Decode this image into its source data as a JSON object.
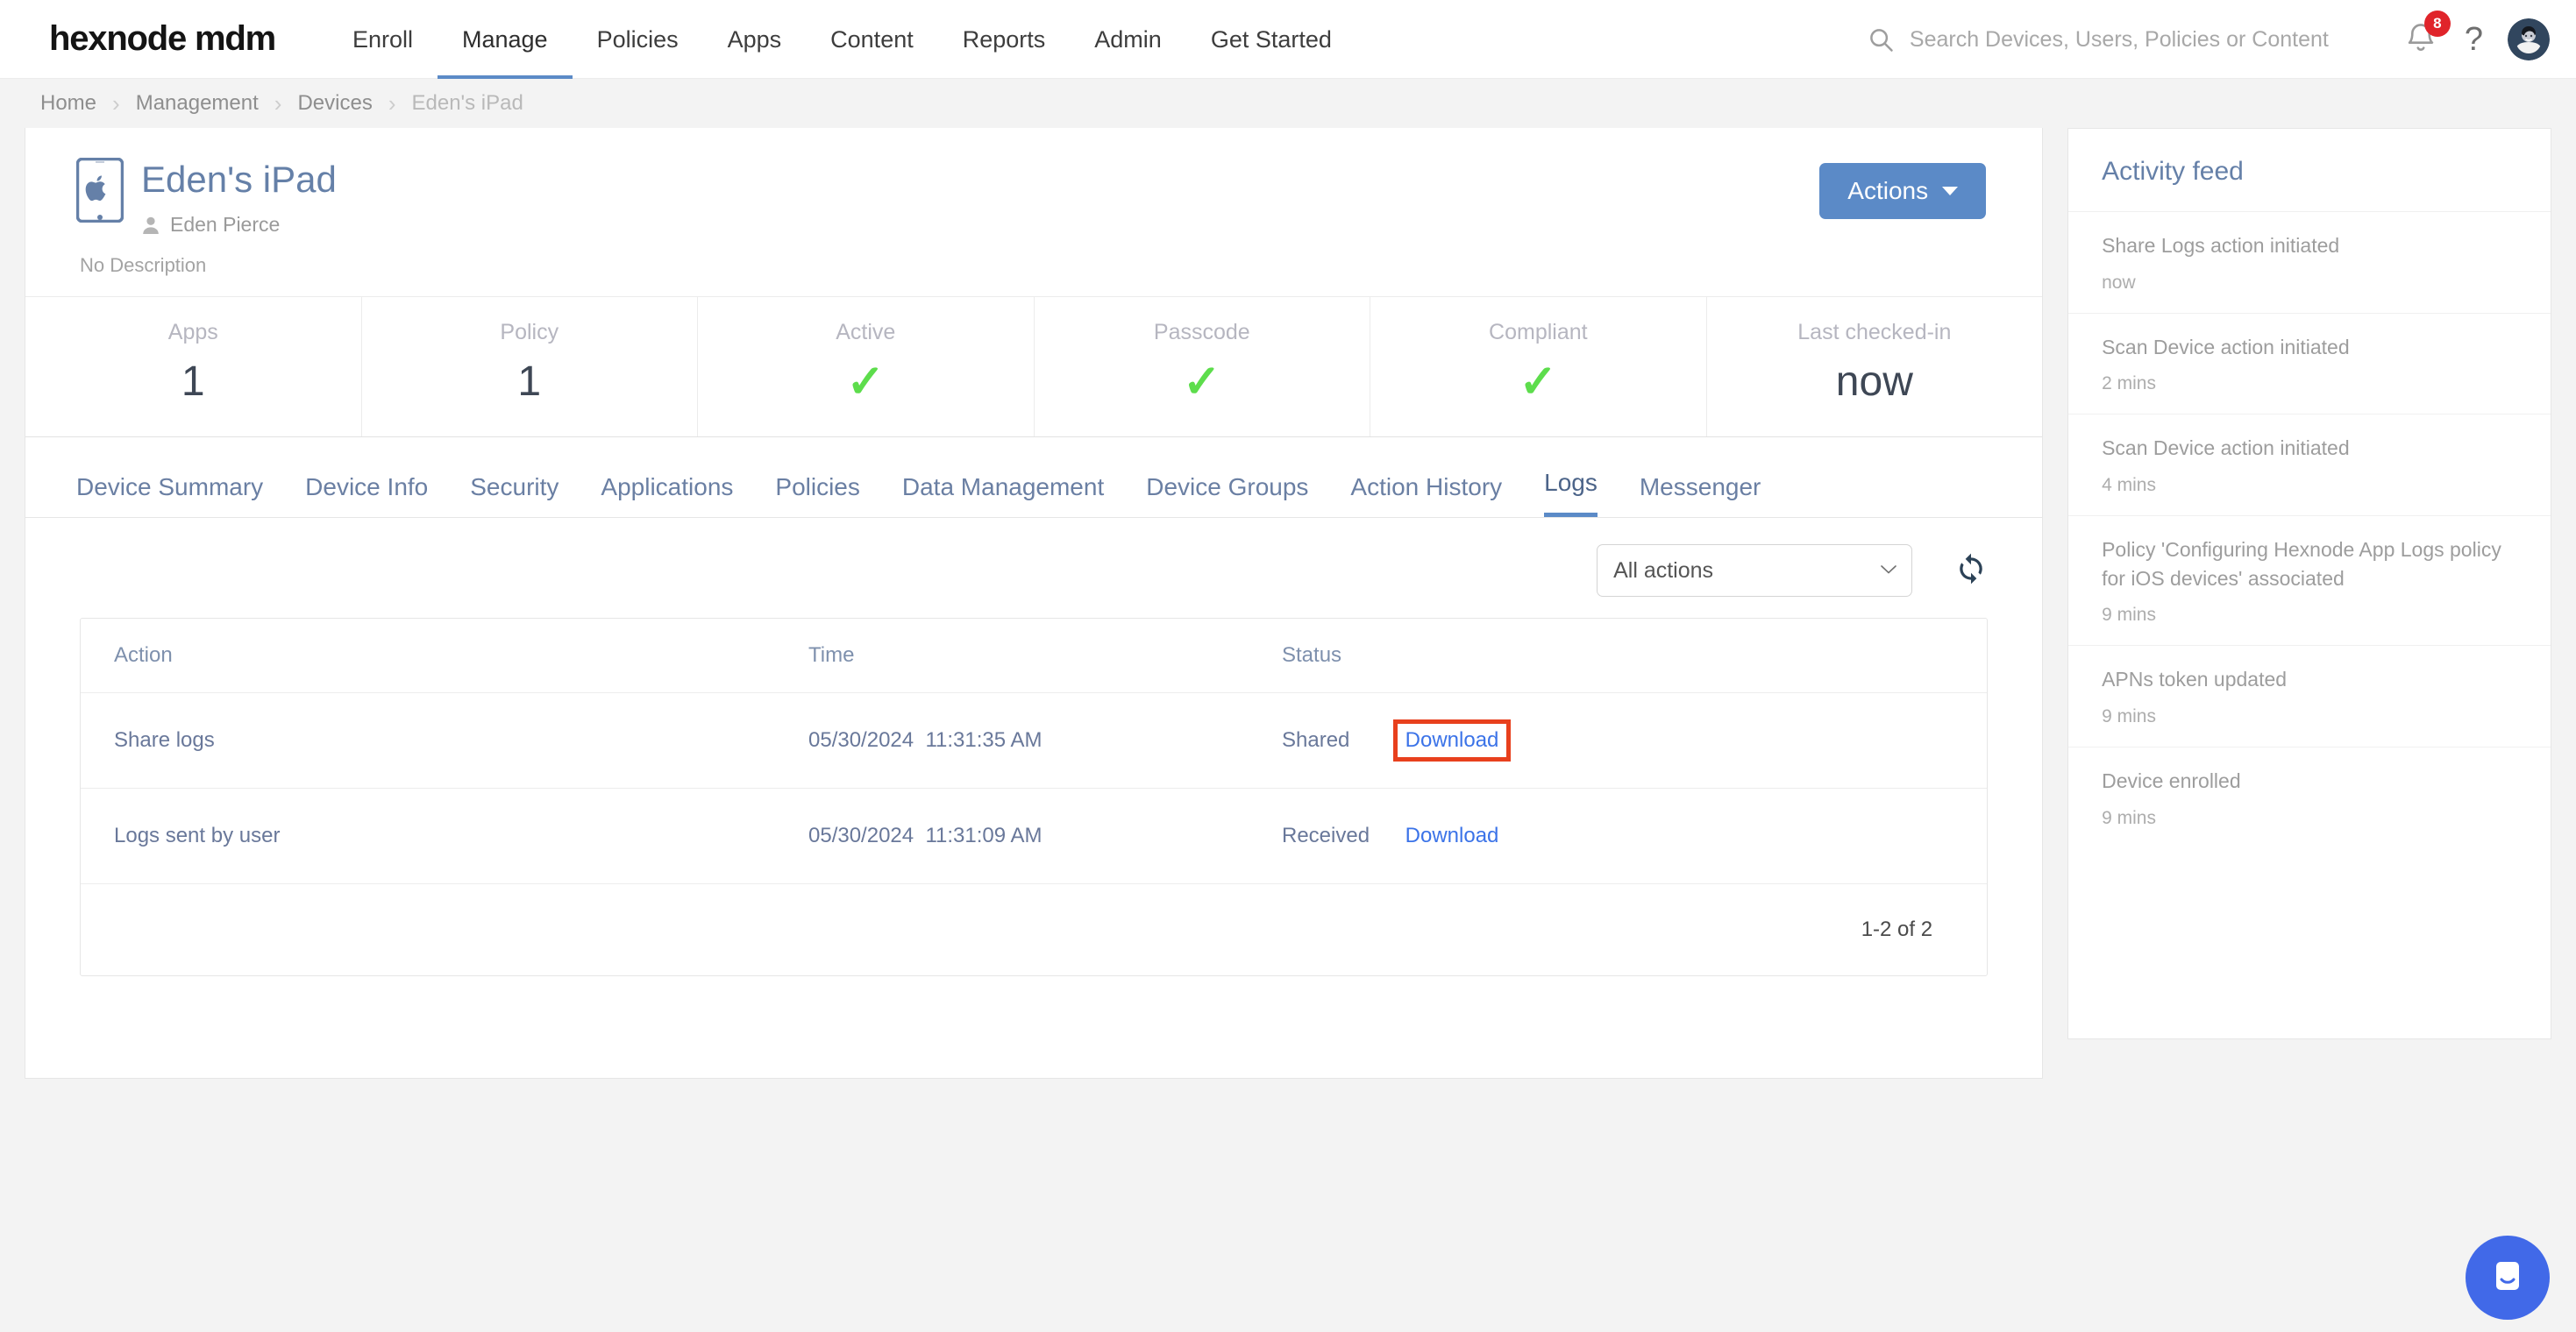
{
  "topnav": {
    "brand": "hexnode mdm",
    "items": [
      {
        "label": "Enroll",
        "active": false
      },
      {
        "label": "Manage",
        "active": true
      },
      {
        "label": "Policies",
        "active": false
      },
      {
        "label": "Apps",
        "active": false
      },
      {
        "label": "Content",
        "active": false
      },
      {
        "label": "Reports",
        "active": false
      },
      {
        "label": "Admin",
        "active": false
      },
      {
        "label": "Get Started",
        "active": false
      }
    ],
    "search_placeholder": "Search Devices, Users, Policies or Content",
    "notification_count": "8",
    "help_glyph": "?",
    "colors": {
      "badge": "#e0242a",
      "active_underline": "#5b8ac7"
    }
  },
  "breadcrumb": {
    "items": [
      "Home",
      "Management",
      "Devices",
      "Eden's iPad"
    ],
    "separator": "›"
  },
  "device": {
    "name": "Eden's iPad",
    "owner": "Eden Pierce",
    "description": "No Description",
    "actions_button": "Actions"
  },
  "stats": [
    {
      "label": "Apps",
      "value": "1",
      "type": "number"
    },
    {
      "label": "Policy",
      "value": "1",
      "type": "number"
    },
    {
      "label": "Active",
      "value": "✓",
      "type": "check"
    },
    {
      "label": "Passcode",
      "value": "✓",
      "type": "check"
    },
    {
      "label": "Compliant",
      "value": "✓",
      "type": "check"
    },
    {
      "label": "Last checked-in",
      "value": "now",
      "type": "text"
    }
  ],
  "tabs": [
    {
      "label": "Device Summary",
      "active": false
    },
    {
      "label": "Device Info",
      "active": false
    },
    {
      "label": "Security",
      "active": false
    },
    {
      "label": "Applications",
      "active": false
    },
    {
      "label": "Policies",
      "active": false
    },
    {
      "label": "Data Management",
      "active": false
    },
    {
      "label": "Device Groups",
      "active": false
    },
    {
      "label": "Action History",
      "active": false
    },
    {
      "label": "Logs",
      "active": true
    },
    {
      "label": "Messenger",
      "active": false
    }
  ],
  "logs": {
    "filter_selected": "All actions",
    "filter_options": [
      "All actions"
    ],
    "columns": [
      "Action",
      "Time",
      "Status"
    ],
    "rows": [
      {
        "action": "Share logs",
        "date": "05/30/2024",
        "time": "11:31:35 AM",
        "status": "Shared",
        "download_label": "Download",
        "highlighted": true
      },
      {
        "action": "Logs sent by user",
        "date": "05/30/2024",
        "time": "11:31:09 AM",
        "status": "Received",
        "download_label": "Download",
        "highlighted": false
      }
    ],
    "pagination": "1-2 of 2",
    "highlight_color": "#e8401d",
    "link_color": "#3b73e8"
  },
  "activity_feed": {
    "title": "Activity feed",
    "items": [
      {
        "text": "Share Logs action initiated",
        "time": "now"
      },
      {
        "text": "Scan Device action initiated",
        "time": "2 mins"
      },
      {
        "text": "Scan Device action initiated",
        "time": "4 mins"
      },
      {
        "text": "Policy 'Configuring Hexnode App Logs policy for iOS devices' associated",
        "time": "9 mins"
      },
      {
        "text": "APNs token updated",
        "time": "9 mins"
      },
      {
        "text": "Device enrolled",
        "time": "9 mins"
      }
    ]
  },
  "chat_widget": {
    "color": "#4169e8"
  }
}
